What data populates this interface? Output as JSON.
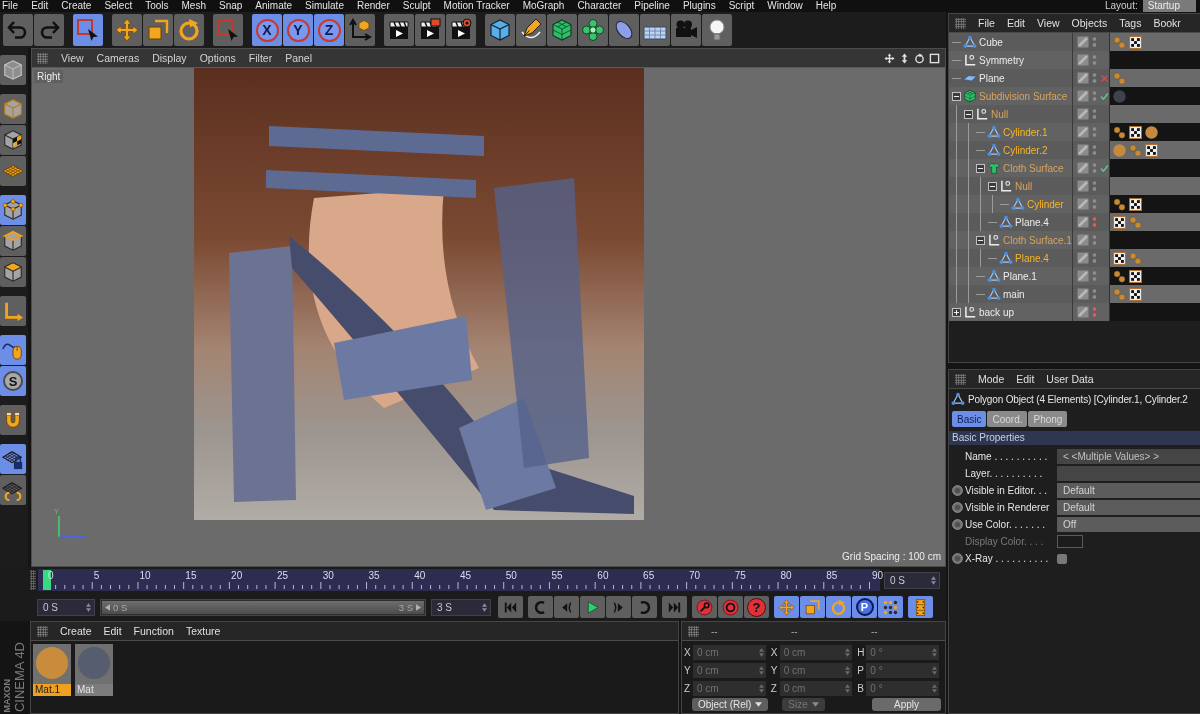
{
  "menu_bar": {
    "items": [
      "File",
      "Edit",
      "Create",
      "Select",
      "Tools",
      "Mesh",
      "Snap",
      "Animate",
      "Simulate",
      "Render",
      "Sculpt",
      "Motion Tracker",
      "MoGraph",
      "Character",
      "Pipeline",
      "Plugins",
      "Script",
      "Window",
      "Help"
    ],
    "layout_label": "Layout:",
    "layout_value": "Startup"
  },
  "toolbar": [
    [
      {
        "kind": "undo",
        "selected": false
      },
      {
        "kind": "redo",
        "selected": false
      }
    ],
    [
      {
        "kind": "live-select",
        "selected": true
      }
    ],
    [
      {
        "kind": "move",
        "selected": false
      },
      {
        "kind": "scale",
        "selected": false
      },
      {
        "kind": "rotate",
        "selected": false
      }
    ],
    [
      {
        "kind": "rect-select",
        "selected": false
      }
    ],
    [
      {
        "kind": "axis",
        "label": "X",
        "selected": true
      },
      {
        "kind": "axis",
        "label": "Y",
        "selected": true
      },
      {
        "kind": "axis",
        "label": "Z",
        "selected": true
      },
      {
        "kind": "coord-system",
        "selected": false
      }
    ],
    [
      {
        "kind": "render-view",
        "selected": false
      },
      {
        "kind": "render-picture",
        "selected": false
      },
      {
        "kind": "render-settings",
        "selected": false
      }
    ],
    [
      {
        "kind": "cube",
        "selected": false
      },
      {
        "kind": "pen",
        "selected": false
      },
      {
        "kind": "subdivision",
        "selected": false
      },
      {
        "kind": "cloner",
        "selected": false
      },
      {
        "kind": "deformer",
        "selected": false
      },
      {
        "kind": "floor",
        "selected": false
      },
      {
        "kind": "camera",
        "selected": false
      },
      {
        "kind": "light",
        "selected": false
      }
    ]
  ],
  "left_toolbar": [
    [
      {
        "kind": "editable",
        "selected": false
      }
    ],
    [
      {
        "kind": "model",
        "selected": false
      },
      {
        "kind": "texture",
        "selected": false
      },
      {
        "kind": "workplane",
        "selected": false
      }
    ],
    [
      {
        "kind": "points",
        "selected": true
      },
      {
        "kind": "edges",
        "selected": false
      },
      {
        "kind": "polygons",
        "selected": false
      }
    ],
    [
      {
        "kind": "axis-mode",
        "selected": false
      }
    ],
    [
      {
        "kind": "tweak",
        "selected": true
      },
      {
        "kind": "solo",
        "label": "S",
        "selected": true
      }
    ],
    [
      {
        "kind": "snap",
        "selected": false
      }
    ],
    [
      {
        "kind": "lock-workplane",
        "selected": true
      },
      {
        "kind": "planar-workplane",
        "selected": false
      }
    ]
  ],
  "viewport": {
    "menu": [
      "View",
      "Cameras",
      "Display",
      "Options",
      "Filter",
      "Panel"
    ],
    "view_name": "Right",
    "grid_spacing": "Grid Spacing : 100 cm",
    "axis_label": "Y"
  },
  "timeline": {
    "ticks": [
      "0",
      "5",
      "10",
      "15",
      "20",
      "25",
      "30",
      "35",
      "40",
      "45",
      "50",
      "55",
      "60",
      "65",
      "70",
      "75",
      "80",
      "85",
      "90"
    ],
    "playhead": {
      "level": 0
    },
    "current_frame": "0 S"
  },
  "playback": {
    "start": "0 S",
    "range": {
      "start": "0 S",
      "end": "3 S",
      "level": 1
    },
    "end": "3 S",
    "buttons": [
      [
        {
          "kind": "go-start"
        }
      ],
      [
        {
          "kind": "prev-key"
        },
        {
          "kind": "prev-frame"
        },
        {
          "kind": "play"
        },
        {
          "kind": "next-frame"
        },
        {
          "kind": "next-key"
        }
      ],
      [
        {
          "kind": "go-end"
        }
      ],
      [
        {
          "kind": "record"
        },
        {
          "kind": "autokey"
        },
        {
          "kind": "key-selection",
          "label": "?"
        }
      ],
      [
        {
          "kind": "move",
          "selected": true
        },
        {
          "kind": "scale",
          "selected": true
        },
        {
          "kind": "rotate",
          "selected": true
        },
        {
          "kind": "param",
          "label": "P",
          "selected": true
        },
        {
          "kind": "point-level",
          "selected": true
        }
      ],
      [
        {
          "kind": "timeline",
          "selected": true
        }
      ]
    ]
  },
  "materials": {
    "menu": [
      "Create",
      "Edit",
      "Function",
      "Texture"
    ],
    "items": [
      {
        "name": "Mat.1",
        "selected": true,
        "color": "#c98b3c"
      },
      {
        "name": "Mat",
        "selected": false,
        "color": "#565d6e"
      }
    ]
  },
  "coordinates": {
    "headers": [
      "--",
      "--",
      "--"
    ],
    "rows": [
      [
        {
          "axis": "X",
          "value": "0 cm",
          "disabled": true
        },
        {
          "axis": "X",
          "value": "0 cm",
          "disabled": true
        },
        {
          "axis": "H",
          "value": "0 °",
          "disabled": true
        }
      ],
      [
        {
          "axis": "Y",
          "value": "0 cm",
          "disabled": true
        },
        {
          "axis": "Y",
          "value": "0 cm",
          "disabled": true
        },
        {
          "axis": "P",
          "value": "0 °",
          "disabled": true
        }
      ],
      [
        {
          "axis": "Z",
          "value": "0 cm",
          "disabled": true
        },
        {
          "axis": "Z",
          "value": "0 cm",
          "disabled": true
        },
        {
          "axis": "B",
          "value": "0 °",
          "disabled": true
        }
      ]
    ],
    "mode": "Object (Rel)",
    "size_mode": {
      "label": "Size",
      "disabled": true
    },
    "apply": "Apply"
  },
  "logo": [
    "MAXON",
    "CINEMA 4D"
  ],
  "object_manager": {
    "menu": [
      "File",
      "Edit",
      "View",
      "Objects",
      "Tags",
      "Bookr"
    ],
    "objects": [
      {
        "name": "Cube",
        "kind": "polygon",
        "selected": false,
        "child_selected": false,
        "visible": true,
        "tags": [
          {
            "kind": "phong"
          },
          {
            "kind": "texture"
          }
        ]
      },
      {
        "name": "Symmetry",
        "kind": "null",
        "selected": false,
        "child_selected": false,
        "visible": true
      },
      {
        "name": "Plane",
        "kind": "plane",
        "selected": false,
        "child_selected": false,
        "visible": true,
        "enabled": false,
        "tags": [
          {
            "kind": "phong"
          }
        ]
      },
      {
        "name": "Subdivision Surface",
        "kind": "subdivision",
        "selected": false,
        "child_selected": true,
        "visible": true,
        "enabled": true,
        "expanded": true,
        "tags": [
          {
            "kind": "material",
            "color": "#3e424c"
          }
        ],
        "children": [
          {
            "name": "Null",
            "kind": "null",
            "selected": false,
            "child_selected": true,
            "visible": true,
            "expanded": true,
            "children": [
              {
                "name": "Cylinder.1",
                "kind": "polygon",
                "selected": true,
                "child_selected": false,
                "visible": true,
                "tags": [
                  {
                    "kind": "phong"
                  },
                  {
                    "kind": "texture"
                  },
                  {
                    "kind": "material",
                    "color": "#c68a3e"
                  }
                ]
              },
              {
                "name": "Cylinder.2",
                "kind": "polygon",
                "selected": true,
                "child_selected": false,
                "visible": true,
                "tags": [
                  {
                    "kind": "material",
                    "color": "#c68a3e"
                  },
                  {
                    "kind": "phong"
                  },
                  {
                    "kind": "texture"
                  }
                ]
              },
              {
                "name": "Cloth Surface",
                "kind": "cloth",
                "selected": false,
                "child_selected": true,
                "visible": true,
                "enabled": true,
                "expanded": true,
                "children": [
                  {
                    "name": "Null",
                    "kind": "null",
                    "selected": false,
                    "child_selected": true,
                    "visible": true,
                    "expanded": true,
                    "children": [
                      {
                        "name": "Cylinder",
                        "kind": "polygon",
                        "selected": true,
                        "child_selected": false,
                        "visible": true,
                        "tags": [
                          {
                            "kind": "phong"
                          },
                          {
                            "kind": "texture"
                          }
                        ]
                      }
                    ]
                  },
                  {
                    "name": "Plane.4",
                    "kind": "polygon",
                    "selected": false,
                    "child_selected": false,
                    "visible": false,
                    "tags": [
                      {
                        "kind": "texture"
                      },
                      {
                        "kind": "phong"
                      }
                    ]
                  }
                ]
              },
              {
                "name": "Cloth Surface.1",
                "kind": "null",
                "selected": false,
                "child_selected": true,
                "visible": true,
                "expanded": true,
                "children": [
                  {
                    "name": "Plane.4",
                    "kind": "polygon",
                    "selected": true,
                    "child_selected": false,
                    "visible": true,
                    "tags": [
                      {
                        "kind": "texture"
                      },
                      {
                        "kind": "phong"
                      }
                    ]
                  }
                ]
              },
              {
                "name": "Plane.1",
                "kind": "polygon",
                "selected": false,
                "child_selected": false,
                "visible": true,
                "tags": [
                  {
                    "kind": "phong"
                  },
                  {
                    "kind": "texture"
                  }
                ]
              },
              {
                "name": "main",
                "kind": "polygon",
                "selected": false,
                "child_selected": false,
                "visible": true,
                "tags": [
                  {
                    "kind": "phong"
                  },
                  {
                    "kind": "texture"
                  }
                ]
              }
            ]
          }
        ]
      },
      {
        "name": "back up",
        "kind": "null",
        "selected": false,
        "child_selected": false,
        "visible": false,
        "expanded": false
      }
    ]
  },
  "attributes": {
    "menu": [
      "Mode",
      "Edit",
      "User Data"
    ],
    "title": "Polygon Object (4 Elements) [Cylinder.1, Cylinder.2",
    "tabs": [
      {
        "label": "Basic",
        "selected": true
      },
      {
        "label": "Coord.",
        "selected": false
      },
      {
        "label": "Phong",
        "selected": false
      }
    ],
    "section": "Basic Properties",
    "fields": [
      {
        "kind": "text",
        "label": "Name . . . . . . . . . .",
        "value": "< <Multiple Values> >",
        "keyframe": false,
        "disabled": false
      },
      {
        "kind": "text",
        "label": "Layer. . . . . . . . . .",
        "keyframe": false,
        "disabled": false
      },
      {
        "kind": "dropdown",
        "label": "Visible in Editor. . .",
        "value": "Default",
        "keyframe": true,
        "disabled": false
      },
      {
        "kind": "dropdown",
        "label": "Visible in Renderer",
        "value": "Default",
        "keyframe": true,
        "disabled": false
      },
      {
        "kind": "dropdown",
        "label": "Use Color. . . . . . .",
        "value": "Off",
        "keyframe": true,
        "disabled": false
      },
      {
        "kind": "color",
        "label": "Display Color. . . .",
        "color": "#1c1c1c",
        "keyframe": false,
        "disabled": true
      },
      {
        "kind": "checkbox",
        "label": "X-Ray . . . . . . . . . .",
        "checked": false,
        "keyframe": true,
        "disabled": false
      }
    ]
  }
}
